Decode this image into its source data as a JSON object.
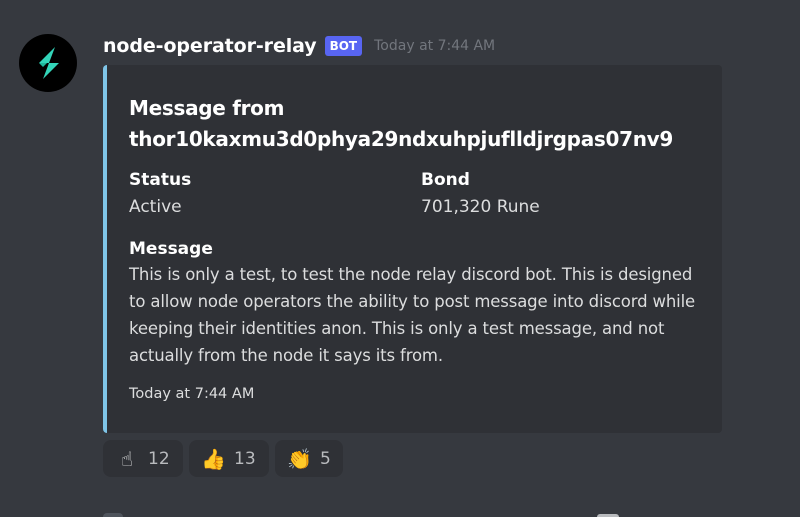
{
  "message": {
    "username": "node-operator-relay",
    "bot_tag": "BOT",
    "timestamp": "Today at 7:44 AM",
    "avatar_icon": "thorchain-lightning-icon",
    "colors": {
      "background": "#36393f",
      "embed_background": "#2f3136",
      "embed_accent": "#7fc5e8",
      "bot_tag": "#5865f2",
      "avatar_bolt": "#33d5b9"
    }
  },
  "embed": {
    "title": "Message from thor10kaxmu3d0phya29ndxuhpjuflldjrgpas07nv9",
    "fields": {
      "status": {
        "name": "Status",
        "value": "Active"
      },
      "bond": {
        "name": "Bond",
        "value": "701,320 Rune"
      },
      "message": {
        "name": "Message",
        "value": "This is only a test, to test the node relay discord bot. This is designed to allow node operators the ability to post message into discord while keeping their identities anon. This is only a test message, and not actually from the node it says its from."
      }
    },
    "footer": "Today at 7:44 AM"
  },
  "reactions": [
    {
      "emoji": "☝",
      "icon": "point-up-icon",
      "count": "12"
    },
    {
      "emoji": "👍",
      "icon": "thumbs-up-icon",
      "count": "13"
    },
    {
      "emoji": "👏",
      "icon": "clapping-hands-icon",
      "count": "5"
    }
  ]
}
